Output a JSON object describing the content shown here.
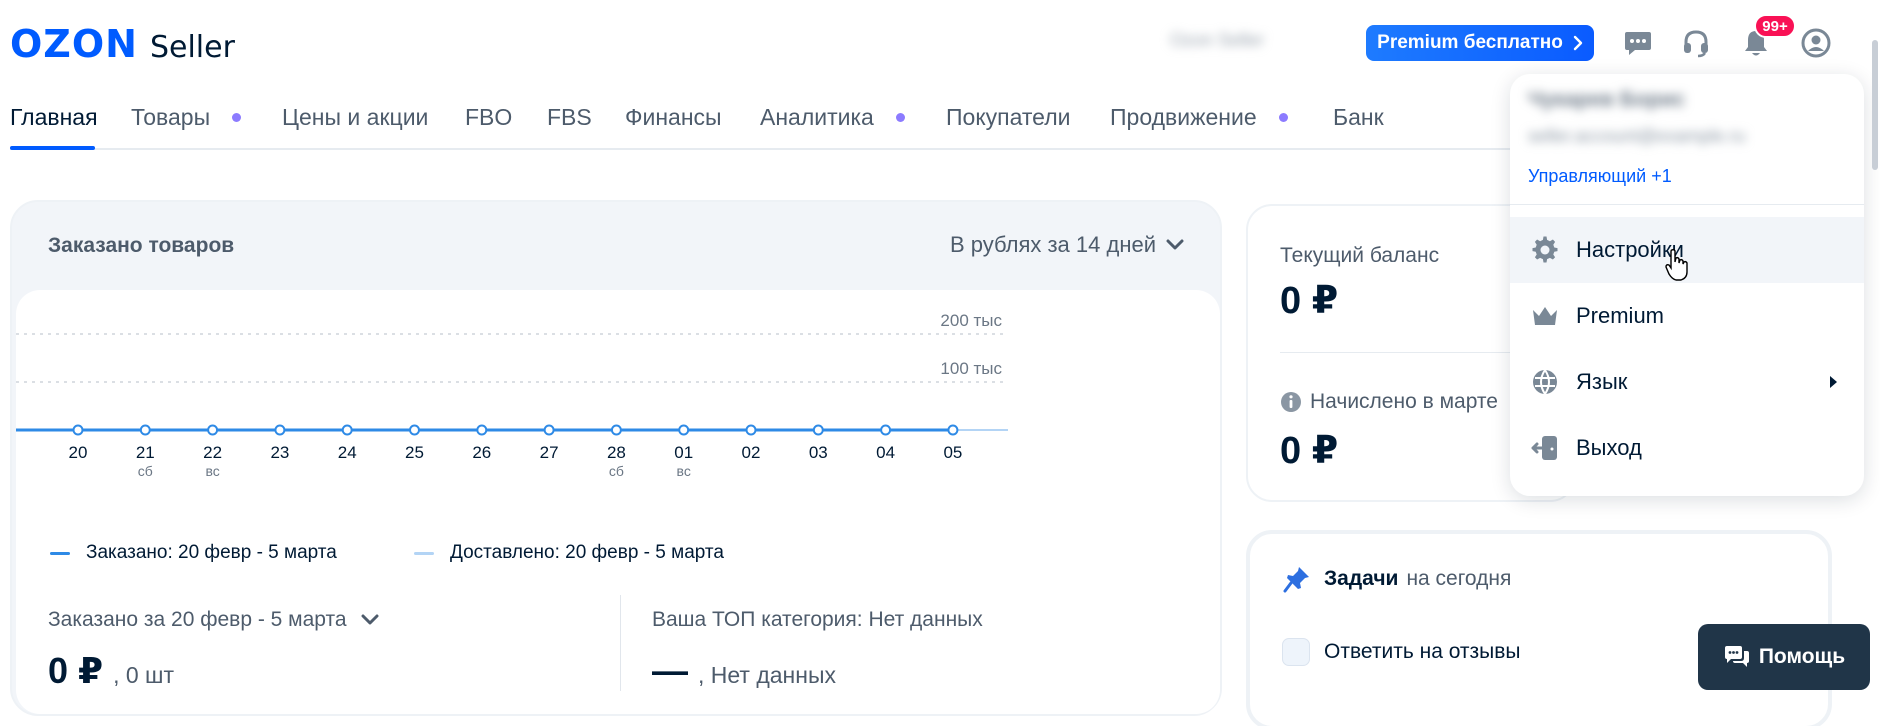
{
  "header": {
    "logo_brand": "OZON",
    "logo_product": "Seller",
    "account_blurred": "Ozon Seller",
    "premium_label": "Premium бесплатно",
    "notifications_badge": "99+",
    "icons": [
      "chat-icon",
      "headset-icon",
      "bell-icon",
      "user-icon"
    ]
  },
  "nav": {
    "items": [
      {
        "label": "Главная",
        "active": true,
        "dot": false
      },
      {
        "label": "Товары",
        "active": false,
        "dot": true
      },
      {
        "label": "Цены и акции",
        "active": false,
        "dot": false
      },
      {
        "label": "FBO",
        "active": false,
        "dot": false
      },
      {
        "label": "FBS",
        "active": false,
        "dot": false
      },
      {
        "label": "Финансы",
        "active": false,
        "dot": false
      },
      {
        "label": "Аналитика",
        "active": false,
        "dot": true
      },
      {
        "label": "Покупатели",
        "active": false,
        "dot": false
      },
      {
        "label": "Продвижение",
        "active": false,
        "dot": true
      },
      {
        "label": "Банк",
        "active": false,
        "dot": false
      }
    ]
  },
  "orders": {
    "title": "Заказано товаров",
    "period_selector": "В рублях за 14 дней",
    "legend": [
      {
        "label": "Заказано: 20 февр - 5 марта",
        "color": "#2e8ae6"
      },
      {
        "label": "Доставлено: 20 февр - 5 марта",
        "color": "#b3d4f5"
      }
    ],
    "summary_left_label": "Заказано за 20 февр - 5 марта",
    "summary_left_value": "0 ₽",
    "summary_left_sub": ", 0 шт",
    "summary_right_label": "Ваша ТОП категория: Нет данных",
    "summary_right_value": "—",
    "summary_right_sub": ", Нет данных"
  },
  "chart_data": {
    "type": "line",
    "categories": [
      "20",
      "21",
      "22",
      "23",
      "24",
      "25",
      "26",
      "27",
      "28",
      "01",
      "02",
      "03",
      "04",
      "05"
    ],
    "weekday_labels": [
      "",
      "сб",
      "вс",
      "",
      "",
      "",
      "",
      "",
      "сб",
      "вс",
      "",
      "",
      "",
      ""
    ],
    "series": [
      {
        "name": "Заказано: 20 февр - 5 марта",
        "values": [
          0,
          0,
          0,
          0,
          0,
          0,
          0,
          0,
          0,
          0,
          0,
          0,
          0,
          0
        ],
        "color": "#2e8ae6"
      },
      {
        "name": "Доставлено: 20 февр - 5 марта",
        "values": [
          0,
          0,
          0,
          0,
          0,
          0,
          0,
          0,
          0,
          0,
          0,
          0,
          0,
          0
        ],
        "color": "#b3d4f5"
      }
    ],
    "yticks": [
      "100 тыс",
      "200 тыс"
    ],
    "ylim": [
      0,
      200000
    ],
    "grid": true,
    "grid_style": "dotted"
  },
  "balance": {
    "current_label": "Текущий баланс",
    "current_value": "0 ₽",
    "accrued_label": "Начислено в марте",
    "accrued_value": "0 ₽"
  },
  "tasks": {
    "title": "Задачи",
    "subtitle": "на сегодня",
    "items": [
      {
        "label": "Ответить на отзывы"
      }
    ]
  },
  "help": {
    "label": "Помощь"
  },
  "dropdown": {
    "name_blurred": "Чукарев Борис",
    "email_blurred": "seller.account@example.ru",
    "role": "Управляющий +1",
    "items": [
      {
        "label": "Настройки",
        "icon": "gear-icon"
      },
      {
        "label": "Premium",
        "icon": "crown-icon"
      },
      {
        "label": "Язык",
        "icon": "globe-icon"
      },
      {
        "label": "Выход",
        "icon": "logout-icon"
      }
    ]
  },
  "colors": {
    "brand": "#005bff",
    "text": "#001a34",
    "muted": "#4d5b6b",
    "accent_dot": "#8c7bff",
    "badge": "#f91155"
  }
}
